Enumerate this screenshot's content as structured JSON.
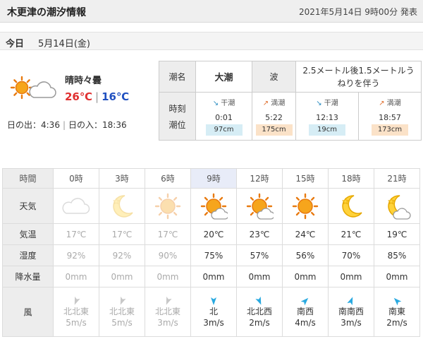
{
  "header": {
    "title": "木更津の潮汐情報",
    "published": "2021年5月14日 9時00分 発表"
  },
  "datebar": {
    "today_label": "今日",
    "date": "5月14日(金)"
  },
  "summary": {
    "condition": "晴時々曇",
    "high": "26℃",
    "low": "16℃",
    "sunrise": "日の出：4:36",
    "sunset": "日の入：18:36",
    "icon": "sun-cloud-icon"
  },
  "tide": {
    "name_label": "潮名",
    "name": "大潮",
    "wave_label": "波",
    "wave": "2.5メートル後1.5メートルうねりを伴う",
    "time_label": "時刻",
    "level_label": "潮位",
    "events": [
      {
        "kind": "干潮",
        "time": "0:01",
        "level": "97cm",
        "type": "low"
      },
      {
        "kind": "満潮",
        "time": "5:22",
        "level": "175cm",
        "type": "high"
      },
      {
        "kind": "干潮",
        "time": "12:13",
        "level": "19cm",
        "type": "low"
      },
      {
        "kind": "満潮",
        "time": "18:57",
        "level": "173cm",
        "type": "high"
      }
    ]
  },
  "forecast": {
    "labels": {
      "time": "時間",
      "weather": "天気",
      "temp": "気温",
      "humidity": "湿度",
      "precip": "降水量",
      "wind": "風"
    },
    "hours": [
      {
        "time": "0時",
        "icon": "cloud-icon",
        "temp": "17℃",
        "humidity": "92%",
        "precip": "0mm",
        "wind_dir": "北北東",
        "wind_speed": "5m/s",
        "past": true
      },
      {
        "time": "3時",
        "icon": "moon-icon",
        "temp": "17℃",
        "humidity": "92%",
        "precip": "0mm",
        "wind_dir": "北北東",
        "wind_speed": "5m/s",
        "past": true
      },
      {
        "time": "6時",
        "icon": "sun-icon",
        "temp": "17℃",
        "humidity": "90%",
        "precip": "0mm",
        "wind_dir": "北北東",
        "wind_speed": "3m/s",
        "past": true
      },
      {
        "time": "9時",
        "icon": "sun-cloud-icon",
        "temp": "20℃",
        "humidity": "75%",
        "precip": "0mm",
        "wind_dir": "北",
        "wind_speed": "3m/s",
        "past": false
      },
      {
        "time": "12時",
        "icon": "sun-cloud-icon",
        "temp": "23℃",
        "humidity": "57%",
        "precip": "0mm",
        "wind_dir": "北北西",
        "wind_speed": "2m/s",
        "past": false
      },
      {
        "time": "15時",
        "icon": "sun-icon",
        "temp": "24℃",
        "humidity": "56%",
        "precip": "0mm",
        "wind_dir": "南西",
        "wind_speed": "4m/s",
        "past": false
      },
      {
        "time": "18時",
        "icon": "moon-icon",
        "temp": "21℃",
        "humidity": "70%",
        "precip": "0mm",
        "wind_dir": "南南西",
        "wind_speed": "3m/s",
        "past": false
      },
      {
        "time": "21時",
        "icon": "moon-cloud-icon",
        "temp": "19℃",
        "humidity": "85%",
        "precip": "0mm",
        "wind_dir": "南東",
        "wind_speed": "2m/s",
        "past": false
      }
    ]
  },
  "colors": {
    "high_temp": "#e03030",
    "low_temp": "#2050c0",
    "now_column": "#e8ecf8",
    "arrow": "#29a9e0"
  }
}
